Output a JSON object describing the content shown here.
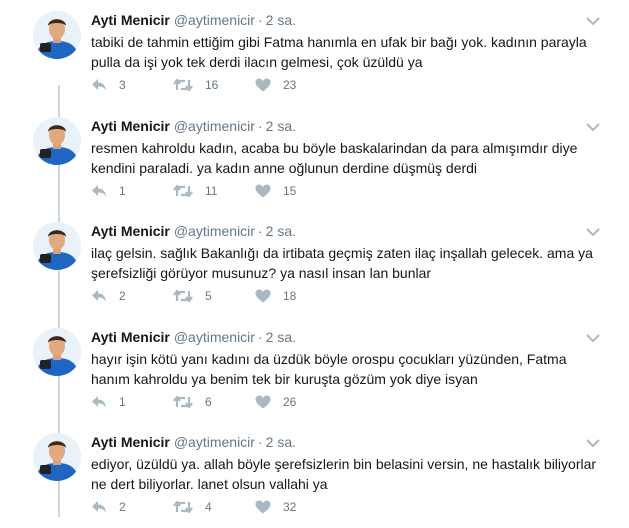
{
  "tweets": [
    {
      "name": "Ayti Menicir",
      "handle": "@aytimenicir",
      "separator": "·",
      "time": "2 sa.",
      "text": "tabiki de tahmin ettiğim gibi Fatma hanımla en ufak bir bağı yok. kadının parayla pulla da işi yok tek derdi ilacın gelmesi, çok üzüldü ya",
      "replies": "3",
      "retweets": "16",
      "likes": "23"
    },
    {
      "name": "Ayti Menicir",
      "handle": "@aytimenicir",
      "separator": "·",
      "time": "2 sa.",
      "text": "resmen kahroldu kadın, acaba bu böyle baskalarindan da para almışımdır diye kendini paraladi. ya kadın anne oğlunun derdine düşmüş derdi",
      "replies": "1",
      "retweets": "11",
      "likes": "15"
    },
    {
      "name": "Ayti Menicir",
      "handle": "@aytimenicir",
      "separator": "·",
      "time": "2 sa.",
      "text": "ilaç gelsin. sağlık Bakanlığı da irtibata geçmiş zaten ilaç inşallah gelecek. ama ya şerefsizliği görüyor musunuz? ya nasıl insan lan bunlar",
      "replies": "2",
      "retweets": "5",
      "likes": "18"
    },
    {
      "name": "Ayti Menicir",
      "handle": "@aytimenicir",
      "separator": "·",
      "time": "2 sa.",
      "text": "hayır işin kötü yanı kadını da üzdük böyle orospu çocukları yüzünden, Fatma hanım kahroldu ya benim tek bir kuruşta gözüm yok diye isyan",
      "replies": "1",
      "retweets": "6",
      "likes": "26"
    },
    {
      "name": "Ayti Menicir",
      "handle": "@aytimenicir",
      "separator": "·",
      "time": "2 sa.",
      "text": "ediyor, üzüldü ya. allah böyle şerefsizlerin bin belasini versin, ne hastalık biliyorlar ne dert biliyorlar. lanet olsun vallahi ya",
      "replies": "2",
      "retweets": "4",
      "likes": "32"
    }
  ],
  "icons": {
    "reply": "reply-icon",
    "retweet": "retweet-icon",
    "like": "heart-icon",
    "caret": "chevron-down-icon",
    "avatar": "avatar"
  },
  "colors": {
    "name": "#14171a",
    "meta": "#657786",
    "action_icon": "#aab8c2",
    "thread_line": "#ccd6dd",
    "avatar_shirt": "#1f66c4"
  }
}
